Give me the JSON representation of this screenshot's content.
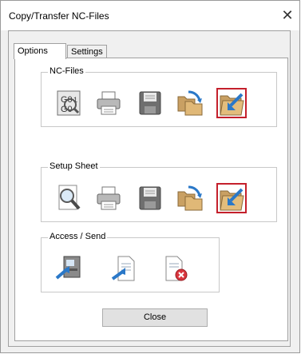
{
  "window": {
    "title": "Copy/Transfer NC-Files",
    "close_glyph": "✕"
  },
  "tabs": [
    {
      "label": "Options"
    },
    {
      "label": "Settings"
    }
  ],
  "groups": {
    "nc_files": {
      "label": "NC-Files",
      "buttons": [
        "gcode-view-icon",
        "print-icon",
        "save-disk-icon",
        "folder-transfer-icon",
        "folder-import-icon"
      ]
    },
    "setup_sheet": {
      "label": "Setup Sheet",
      "buttons": [
        "magnifier-preview-icon",
        "print-icon",
        "save-disk-icon",
        "folder-transfer-icon",
        "folder-import-icon"
      ]
    },
    "access_send": {
      "label": "Access / Send",
      "buttons": [
        "machine-send-icon",
        "document-send-icon",
        "document-delete-icon"
      ]
    }
  },
  "footer": {
    "close_label": "Close"
  },
  "colors": {
    "highlight": "#c4202c"
  }
}
